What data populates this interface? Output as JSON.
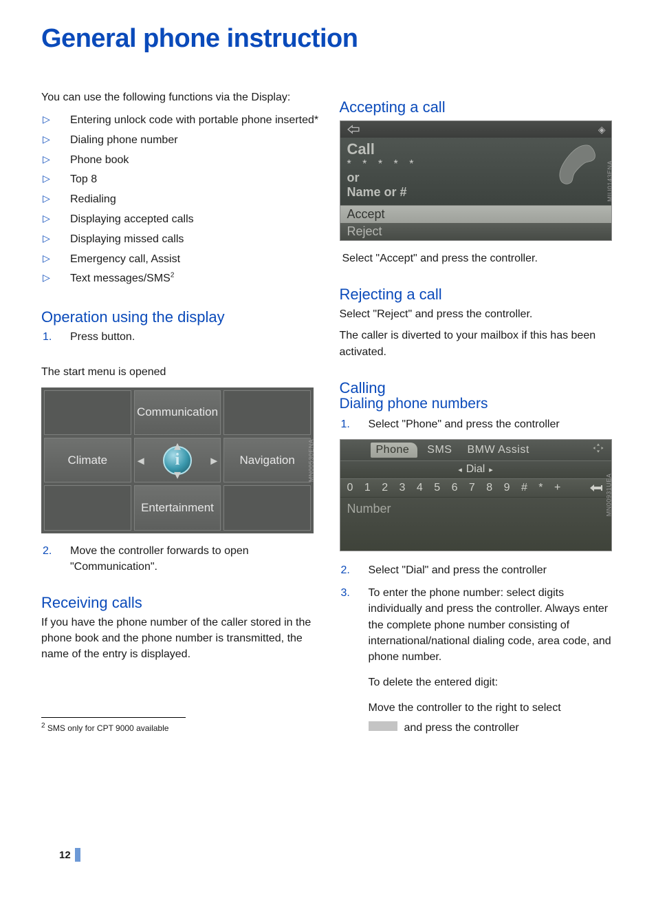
{
  "title": "General phone instruction",
  "left": {
    "intro": "You can use the following functions via the Display:",
    "bullets": [
      "Entering unlock code with portable phone inserted*",
      "Dialing phone number",
      "Phone book",
      "Top 8",
      "Redialing",
      "Displaying accepted calls",
      "Displaying missed calls",
      "Emergency call, Assist",
      "Text messages/SMS"
    ],
    "bullet_sup": "2",
    "op_heading": "Operation using the display",
    "op_step1": "Press button.",
    "op_caption": "The start menu is opened",
    "menu": {
      "top": "Communication",
      "left": "Climate",
      "right": "Navigation",
      "bottom": "Entertainment",
      "code": "MN00530ENA"
    },
    "op_step2": "Move the controller forwards to open \"Communication\".",
    "recv_heading": "Receiving calls",
    "recv_body": "If you have the phone number of the caller stored in the phone book and the phone number is transmitted, the name of the entry is displayed."
  },
  "right": {
    "acc_heading": "Accepting a call",
    "call_shot": {
      "l1": "Call",
      "l2": "* * * * *",
      "l3": "or",
      "l4": "Name or  #",
      "accept": "Accept",
      "reject": "Reject",
      "code": "MIU0143ENA"
    },
    "acc_body": "Select \"Accept\" and press the controller.",
    "rej_heading": "Rejecting a call",
    "rej_body1": "Select \"Reject\" and press the controller.",
    "rej_body2": "The caller is diverted to your mailbox if this has been activated.",
    "call_heading": "Calling",
    "dial_heading": "Dialing phone numbers",
    "dial_step1": "Select \"Phone\" and press the controller",
    "dial_shot": {
      "tabs": [
        "Phone",
        "SMS",
        "BMW Assist"
      ],
      "dial": "Dial",
      "digits": "0 1 2 3 4 5 6 7 8 9 # * +",
      "number": "Number",
      "code": "MN00931UEA"
    },
    "dial_step2": "Select \"Dial\" and press the controller",
    "dial_step3_main": "To enter the phone number: select digits individually and press the controller. Always enter the complete phone number consisting of international/national dialing code, area code, and phone number.",
    "dial_step3_extra": "To delete the entered digit:",
    "dial_step3_sub1": "Move the controller to the right to select",
    "dial_step3_sub2": "and press the controller"
  },
  "footnote_sup": "2",
  "footnote": " SMS only for CPT 9000 available",
  "page": "12"
}
